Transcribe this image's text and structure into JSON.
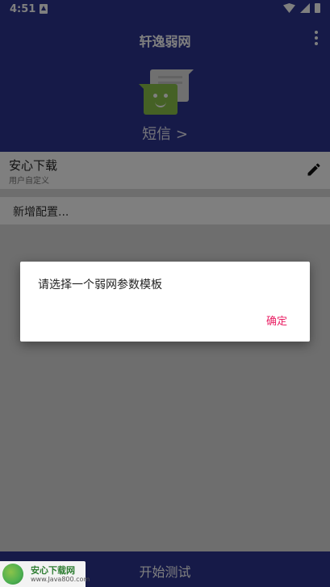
{
  "status_bar": {
    "time": "4:51"
  },
  "header": {
    "title": "轩逸弱网",
    "sms_label": "短信 >"
  },
  "profile": {
    "name": "安心下载",
    "subtitle": "用户自定义"
  },
  "add_config": {
    "label": "新增配置..."
  },
  "bottom": {
    "start_label": "开始测试"
  },
  "dialog": {
    "message": "请选择一个弱网参数模板",
    "ok_label": "确定"
  },
  "watermark": {
    "title": "安心下载网",
    "url": "www.Java800.com"
  },
  "colors": {
    "primary": "#2d3590",
    "accent": "#e91e63",
    "sms_green": "#8bc34a"
  }
}
